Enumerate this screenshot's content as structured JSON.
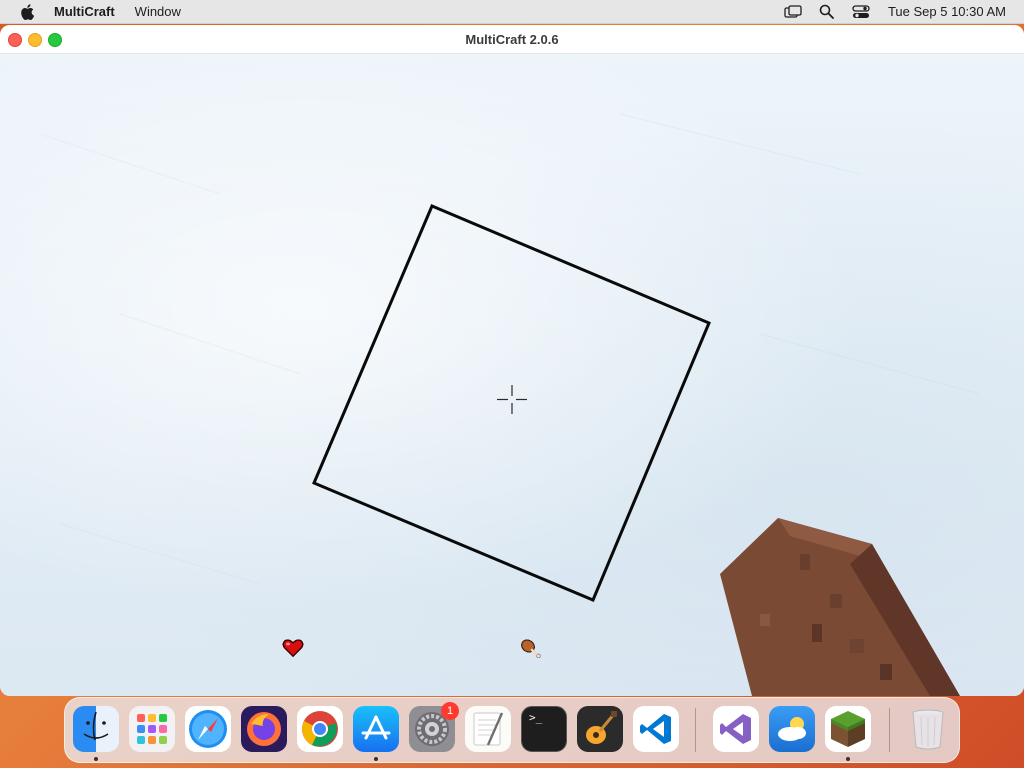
{
  "menubar": {
    "app_name": "MultiCraft",
    "menus": [
      "Window"
    ],
    "clock": "Tue Sep 5  10:30 AM",
    "tray_icons": [
      "screen-mirror-icon",
      "spotlight-search-icon",
      "control-center-icon"
    ]
  },
  "window": {
    "title": "MultiCraft 2.0.6"
  },
  "game": {
    "hud": {
      "health": 10,
      "health_max": 10,
      "hunger": 10,
      "hunger_max": 10
    },
    "selection_outline": "block-outline",
    "crosshair": "crosshair-icon",
    "held_item": "wooden-block-hand"
  },
  "dock": {
    "items": [
      {
        "name": "finder",
        "icon": "finder-icon",
        "running": true
      },
      {
        "name": "launchpad",
        "icon": "launchpad-icon",
        "running": false
      },
      {
        "name": "safari",
        "icon": "safari-icon",
        "running": false
      },
      {
        "name": "firefox",
        "icon": "firefox-icon",
        "running": false
      },
      {
        "name": "chrome",
        "icon": "chrome-icon",
        "running": false
      },
      {
        "name": "app-store",
        "icon": "app-store-icon",
        "running": true
      },
      {
        "name": "system-settings",
        "icon": "gear-icon",
        "running": false,
        "badge": "1"
      },
      {
        "name": "textedit",
        "icon": "textedit-icon",
        "running": false
      },
      {
        "name": "terminal",
        "icon": "terminal-icon",
        "running": false
      },
      {
        "name": "garageband",
        "icon": "guitar-icon",
        "running": false
      },
      {
        "name": "vscode",
        "icon": "vscode-icon",
        "running": false
      },
      {
        "name": "visual-studio",
        "icon": "visual-studio-icon",
        "running": false
      },
      {
        "name": "weather",
        "icon": "weather-icon",
        "running": false
      },
      {
        "name": "multicraft",
        "icon": "multicraft-icon",
        "running": true
      },
      {
        "name": "trash",
        "icon": "trash-icon",
        "running": false
      }
    ],
    "terminal_prompt": ">_"
  }
}
